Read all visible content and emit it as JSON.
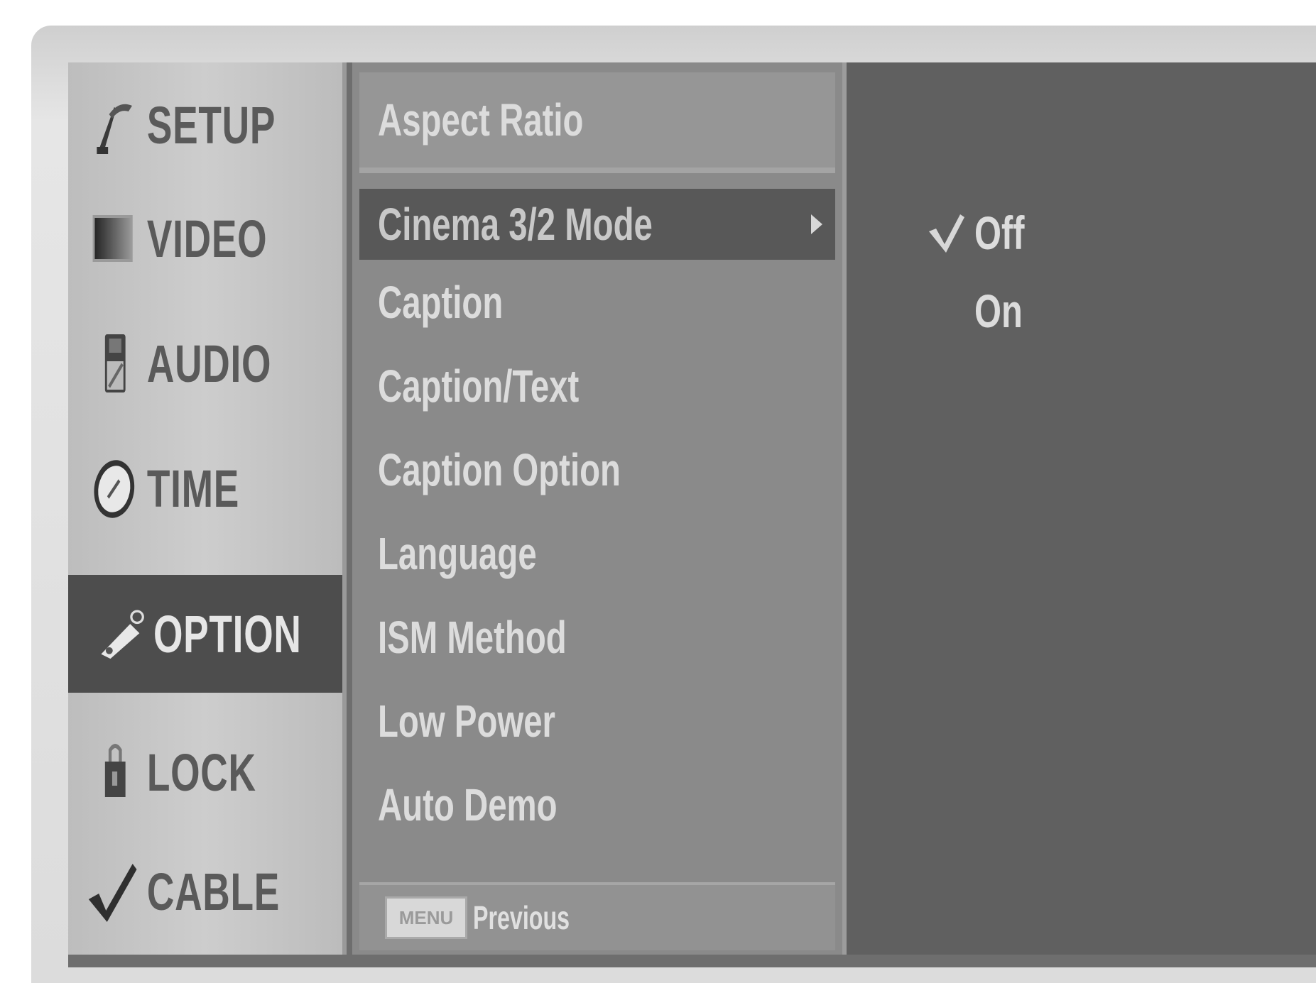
{
  "sidebar": {
    "items": [
      {
        "label": "SETUP",
        "icon": "antenna-icon"
      },
      {
        "label": "VIDEO",
        "icon": "video-icon"
      },
      {
        "label": "AUDIO",
        "icon": "audio-icon"
      },
      {
        "label": "TIME",
        "icon": "clock-icon"
      },
      {
        "label": "OPTION",
        "icon": "option-icon"
      },
      {
        "label": "LOCK",
        "icon": "lock-icon"
      },
      {
        "label": "CABLE",
        "icon": "check-icon"
      }
    ],
    "active": "OPTION"
  },
  "option_menu": {
    "items": [
      {
        "label": "Aspect Ratio"
      },
      {
        "label": "Cinema 3/2 Mode"
      },
      {
        "label": "Caption"
      },
      {
        "label": "Caption/Text"
      },
      {
        "label": "Caption Option"
      },
      {
        "label": "Language"
      },
      {
        "label": "ISM Method"
      },
      {
        "label": "Low Power"
      },
      {
        "label": "Auto Demo"
      }
    ],
    "selected": "Cinema 3/2 Mode",
    "footer": {
      "key_label": "MENU",
      "text": "Previous"
    }
  },
  "submenu": {
    "options": [
      {
        "label": "Off",
        "checked": true
      },
      {
        "label": "On",
        "checked": false
      }
    ]
  },
  "colors": {
    "sidebar_bg": "#c6c6c6",
    "active_bg": "#4d4d4d",
    "list_bg": "#8a8a8a",
    "selected_bg": "#585858",
    "options_bg": "#606060"
  }
}
